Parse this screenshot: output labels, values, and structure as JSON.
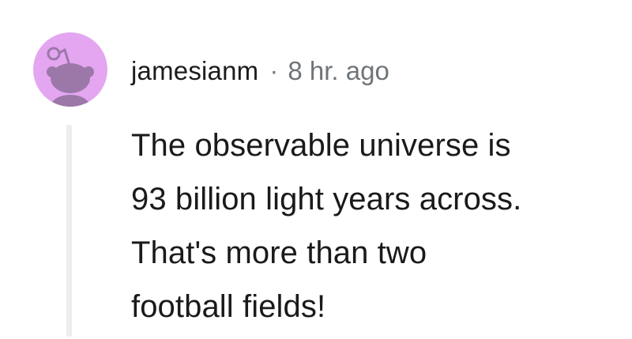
{
  "comment": {
    "author": "jamesianm",
    "separator": "·",
    "timestamp": "8 hr. ago",
    "body_lines": [
      "The observable universe is",
      "93 billion light years across.",
      "That's more than two",
      "football fields!"
    ]
  },
  "colors": {
    "avatar_bg": "#e4a6f0",
    "avatar_figure": "#9b78a8",
    "thread_line": "#eceef0",
    "timestamp": "#6f7579"
  },
  "icons": {
    "avatar": "snoo-avatar-icon"
  }
}
